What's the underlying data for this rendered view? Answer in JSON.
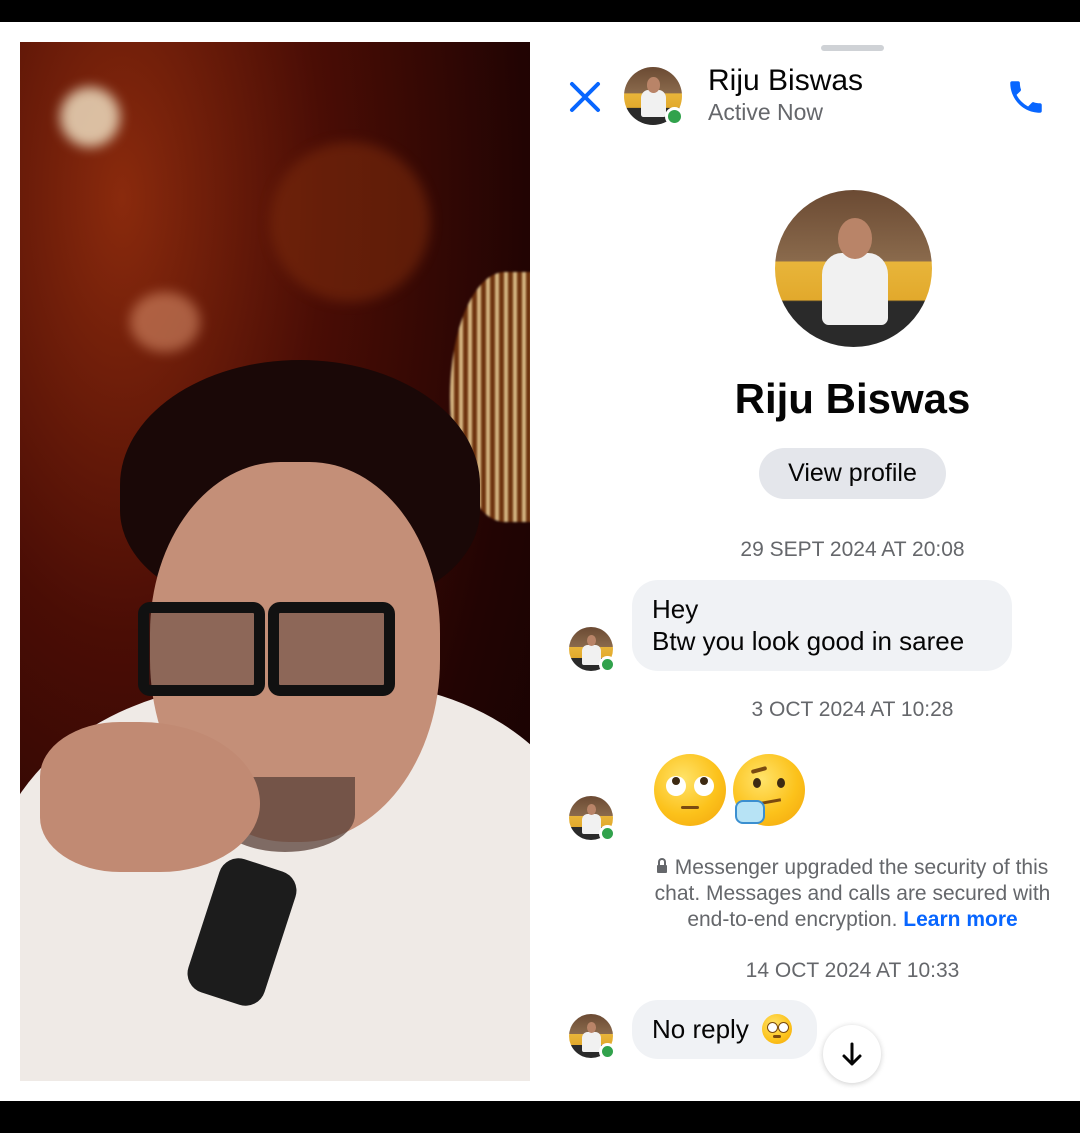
{
  "header": {
    "name": "Riju Biswas",
    "status": "Active Now"
  },
  "profile": {
    "name": "Riju Biswas",
    "view_profile_label": "View profile"
  },
  "messages": [
    {
      "timestamp": "29 SEPT 2024 AT 20:08",
      "lines": [
        "Hey",
        "Btw you look good in saree"
      ]
    },
    {
      "timestamp": "3 OCT 2024 AT 10:28",
      "emojis": [
        "eye-roll-emoji",
        "thinking-emoji"
      ]
    },
    {
      "timestamp": "14 OCT 2024 AT 10:33",
      "text": "No reply",
      "trailing_emoji": "flushed-emoji"
    }
  ],
  "security_notice": {
    "text": "Messenger upgraded the security of this chat. Messages and calls are secured with end-to-end encryption.",
    "link": "Learn more"
  },
  "colors": {
    "accent": "#0866ff",
    "online": "#31a24c",
    "bubble": "#f0f2f5",
    "muted_text": "#65676b"
  },
  "icons": [
    "close-icon",
    "phone-icon",
    "lock-icon",
    "arrow-down-icon"
  ]
}
